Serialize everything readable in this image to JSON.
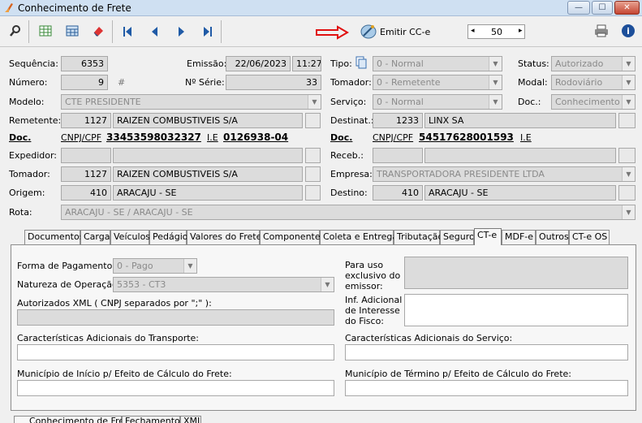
{
  "window": {
    "title": "Conhecimento de Frete",
    "min": "—",
    "max": "☐",
    "close": "✕"
  },
  "toolbar": {
    "emitir_label": "Emitir CC-e",
    "spin_value": "50",
    "spin_left": "◂",
    "spin_right": "▸"
  },
  "header": {
    "sequencia_label": "Sequência:",
    "sequencia": "6353",
    "emissao_label": "Emissão:",
    "emissao_data": "22/06/2023",
    "emissao_hora": "11:27",
    "tipo_label": "Tipo:",
    "tipo": "0 - Normal",
    "status_label": "Status:",
    "status": "Autorizado",
    "numero_label": "Número:",
    "numero": "9",
    "hash": "#",
    "serie_label": "Nº Série:",
    "serie": "33",
    "tomador_top_label": "Tomador:",
    "tomador_top": "0 - Remetente",
    "modal_label": "Modal:",
    "modal": "Rodoviário",
    "modelo_label": "Modelo:",
    "modelo": "CTE PRESIDENTE",
    "servico_label": "Serviço:",
    "servico": "0 - Normal",
    "doc_label": "Doc.:",
    "doc": "Conhecimento",
    "remetente_label": "Remetente:",
    "remetente_cod": "1127",
    "remetente_nome": "RAIZEN COMBUSTIVEIS S/A",
    "destinat_label": "Destinat.:",
    "destinat_cod": "1233",
    "destinat_nome": "LINX SA",
    "rem_doc_label": "Doc.",
    "rem_cnpj_label": "CNPJ/CPF",
    "rem_cnpj": "33453598032327",
    "rem_ie_label": "I.E",
    "rem_ie": "0126938-04",
    "dest_doc_label": "Doc.",
    "dest_cnpj_label": "CNPJ/CPF",
    "dest_cnpj": "54517628001593",
    "dest_ie_label": "I.E",
    "expedidor_label": "Expedidor:",
    "receb_label": "Receb.:",
    "tomador_label": "Tomador:",
    "tomador_cod": "1127",
    "tomador_nome": "RAIZEN COMBUSTIVEIS S/A",
    "empresa_label": "Empresa:",
    "empresa": "TRANSPORTADORA PRESIDENTE LTDA",
    "origem_label": "Origem:",
    "origem_cod": "410",
    "origem_nome": "ARACAJU - SE",
    "destino_label": "Destino:",
    "destino_cod": "410",
    "destino_nome": "ARACAJU - SE",
    "rota_label": "Rota:",
    "rota": "ARACAJU - SE / ARACAJU - SE"
  },
  "tabs": [
    "Documentos",
    "Carga",
    "Veículos",
    "Pedágio",
    "Valores do Frete",
    "Componentes",
    "Coleta e Entrega",
    "Tributação",
    "Seguro",
    "CT-e",
    "MDF-e",
    "Outros",
    "CT-e OS"
  ],
  "cte": {
    "forma_pag_label": "Forma de Pagamento:",
    "forma_pag": "0 - Pago",
    "natureza_label": "Natureza de Operação:",
    "natureza": "5353 - CT3",
    "autorizados_label": "Autorizados XML ( CNPJ separados por \";\" ):",
    "uso_emissor_label_1": "Para uso",
    "uso_emissor_label_2": "exclusivo do",
    "uso_emissor_label_3": "emissor:",
    "inf_fisco_label_1": "Inf. Adicional",
    "inf_fisco_label_2": "de Interesse",
    "inf_fisco_label_3": "do Fisco:",
    "carac_transp_label": "Características Adicionais do Transporte:",
    "carac_serv_label": "Características Adicionais do Serviço:",
    "mun_inicio_label": "Município de Início p/ Efeito de Cálculo do Frete:",
    "mun_termino_label": "Município de Término p/ Efeito de Cálculo do Frete:"
  },
  "bottom_tabs": [
    "Conhecimento de Frete",
    "Fechamento",
    "XML"
  ]
}
